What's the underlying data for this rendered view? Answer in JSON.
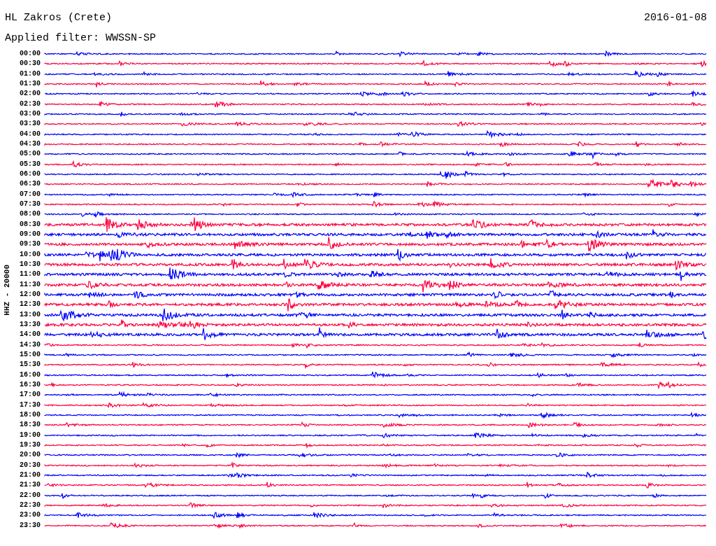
{
  "header": {
    "station": "HL Zakros (Crete)",
    "date": "2016-01-08",
    "filter": "Applied filter: WWSSN-SP"
  },
  "channel_label": "HHZ - 20000",
  "traces": [
    {
      "time": "00:00",
      "color": "#0000ff"
    },
    {
      "time": "00:30",
      "color": "#ff0040"
    },
    {
      "time": "01:00",
      "color": "#0000ff"
    },
    {
      "time": "01:30",
      "color": "#ff0040"
    },
    {
      "time": "02:00",
      "color": "#0000ff"
    },
    {
      "time": "02:30",
      "color": "#ff0040"
    },
    {
      "time": "03:00",
      "color": "#0000ff"
    },
    {
      "time": "03:30",
      "color": "#ff0040"
    },
    {
      "time": "04:00",
      "color": "#0000ff"
    },
    {
      "time": "04:30",
      "color": "#ff0040"
    },
    {
      "time": "05:00",
      "color": "#0000ff"
    },
    {
      "time": "05:30",
      "color": "#ff0040"
    },
    {
      "time": "06:00",
      "color": "#0000ff"
    },
    {
      "time": "06:30",
      "color": "#ff0040"
    },
    {
      "time": "07:00",
      "color": "#0000ff"
    },
    {
      "time": "07:30",
      "color": "#ff0040"
    },
    {
      "time": "08:00",
      "color": "#0000ff"
    },
    {
      "time": "08:30",
      "color": "#ff0040"
    },
    {
      "time": "09:00",
      "color": "#0000ff"
    },
    {
      "time": "09:30",
      "color": "#ff0040"
    },
    {
      "time": "10:00",
      "color": "#0000ff"
    },
    {
      "time": "10:30",
      "color": "#ff0040"
    },
    {
      "time": "11:00",
      "color": "#0000ff"
    },
    {
      "time": "11:30",
      "color": "#ff0040"
    },
    {
      "time": "12:00",
      "color": "#0000ff"
    },
    {
      "time": "12:30",
      "color": "#ff0040"
    },
    {
      "time": "13:00",
      "color": "#0000ff"
    },
    {
      "time": "13:30",
      "color": "#ff0040"
    },
    {
      "time": "14:00",
      "color": "#0000ff"
    },
    {
      "time": "14:30",
      "color": "#ff0040"
    },
    {
      "time": "15:00",
      "color": "#0000ff"
    },
    {
      "time": "15:30",
      "color": "#ff0040"
    },
    {
      "time": "16:00",
      "color": "#0000ff"
    },
    {
      "time": "16:30",
      "color": "#ff0040"
    },
    {
      "time": "17:00",
      "color": "#0000ff"
    },
    {
      "time": "17:30",
      "color": "#ff0040"
    },
    {
      "time": "18:00",
      "color": "#0000ff"
    },
    {
      "time": "18:30",
      "color": "#ff0040"
    },
    {
      "time": "19:00",
      "color": "#0000ff"
    },
    {
      "time": "19:30",
      "color": "#ff0040"
    },
    {
      "time": "20:00",
      "color": "#0000ff"
    },
    {
      "time": "20:30",
      "color": "#ff0040"
    },
    {
      "time": "21:00",
      "color": "#0000ff"
    },
    {
      "time": "21:30",
      "color": "#ff0040"
    },
    {
      "time": "22:00",
      "color": "#0000ff"
    },
    {
      "time": "22:30",
      "color": "#ff0040"
    },
    {
      "time": "23:00",
      "color": "#0000ff"
    },
    {
      "time": "23:30",
      "color": "#ff0040"
    }
  ]
}
